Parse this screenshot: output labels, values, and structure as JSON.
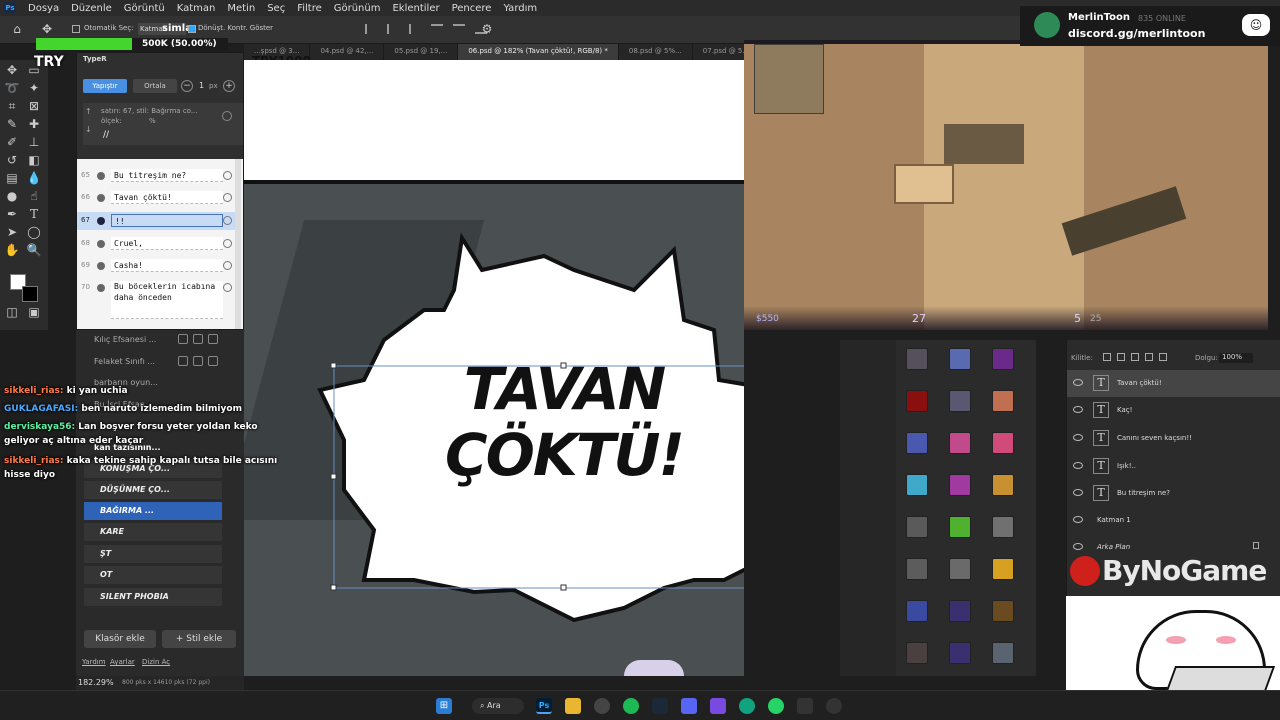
{
  "menu": [
    "Dosya",
    "Düzenle",
    "Görüntü",
    "Katman",
    "Metin",
    "Seç",
    "Filtre",
    "Görünüm",
    "Eklentiler",
    "Pencere",
    "Yardım"
  ],
  "options": {
    "auto_select": "Otomatik Seç:",
    "layer": "Katman",
    "transform": "Dönüşt. Kontr. Göster",
    "progress_text": "500K (50.00%)",
    "progress_value": 0.5,
    "overlay_word": "simla"
  },
  "tabs": [
    "...şpsd @ 3...",
    "04.psd @ 42,...",
    "05.psd @ 19,...",
    "06.psd @ 182% (Tavan çöktü!, RGB/8) *",
    "08.psd @ 5%...",
    "07.psd @ 5..."
  ],
  "overlay": {
    "tag1": "TRY",
    "tag2": "TRY1000"
  },
  "typer": {
    "title": "TypeR",
    "btn_apply": "Yapıştır",
    "btn_center": "Ortala",
    "size_value": "1",
    "size_unit": "px",
    "info_line": "satırı: 67, stil: Bağırma co...",
    "scale_label": "ölçek:",
    "scale_unit": "%",
    "edit_text": "//",
    "lines": [
      {
        "num": "65",
        "text": "Bu titreşim ne?"
      },
      {
        "num": "66",
        "text": "Tavan çöktü!"
      },
      {
        "num": "67",
        "text": "!!"
      },
      {
        "num": "68",
        "text": "Cruel,"
      },
      {
        "num": "69",
        "text": "Casha!"
      },
      {
        "num": "70",
        "text": "Bu böceklerin icabına daha önceden"
      }
    ]
  },
  "styles": {
    "folders": [
      "Kılıç Efsanesi ...",
      "Felaket Sınıfı ...",
      "barbarın oyun...",
      "Bu İşçi Efsan...",
      "kan tazısının..."
    ],
    "items": [
      "KONUŞMA ÇO...",
      "DÜŞÜNME ÇO...",
      "BAĞIRMA ...",
      "KARE",
      "ŞT",
      "OT",
      "SILENT PHOBIA"
    ],
    "add_folder": "Klasör ekle",
    "add_style": "+ Stil ekle",
    "footer": [
      "Yardım",
      "Ayarlar",
      "Dizin Aç"
    ]
  },
  "canvas": {
    "bubble_line1": "TAVAN",
    "bubble_line2": "ÇÖKTÜ!"
  },
  "video": {
    "money": "$550",
    "health": "27",
    "ammo": "5",
    "ammo_reserve": "25"
  },
  "stream": {
    "channel": "MerlinToon",
    "viewers": "835 ONLINE",
    "discord": "discord.gg/merlintoon",
    "sponsor": "ByNoGame"
  },
  "layers": {
    "kind": "Kilitle:",
    "fill_label": "Dolgu:",
    "fill_value": "100%",
    "items": [
      "Tavan çöktü!",
      "Kaç!",
      "Canını seven kaçsın!!",
      "Işık!..",
      "Bu  titreşim  ne?",
      "Katman 1",
      "Arka Plan"
    ]
  },
  "chat": [
    {
      "user": "sikkeli_rias:",
      "text": "ki yan uchia",
      "color": "#ff7b4a"
    },
    {
      "user": "GUKLAGAFASI:",
      "text": "ben naruto izlemedim bilmiyom",
      "color": "#4aa8ff"
    },
    {
      "user": "derviskaya56:",
      "text": "Lan boşver forsu yeter yoldan keko geliyor aç altına eder kaçar",
      "color": "#5cf0a2"
    },
    {
      "user": "sikkeli_rias:",
      "text": "kaka tekine sahip kapalı tutsa bile acısını hisse diyo",
      "color": "#ff7b4a"
    }
  ],
  "status": {
    "zoom": "182.29%",
    "doc": "800 pks x 14610 pks (72 ppi)"
  },
  "taskbar": {
    "search": "Ara"
  }
}
